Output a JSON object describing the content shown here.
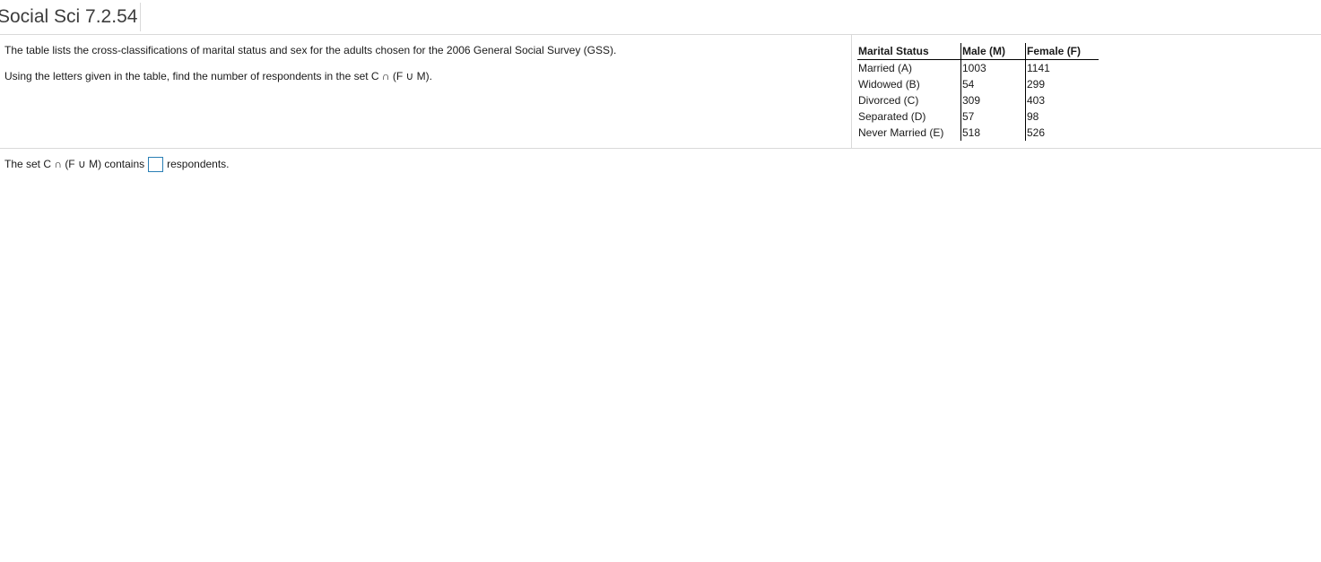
{
  "header": {
    "title": "Social Sci 7.2.54"
  },
  "question": {
    "line1": "The table lists the cross-classifications of marital status and sex for the adults chosen for the 2006 General Social Survey (GSS).",
    "line2": "Using the letters given in the table, find the number of respondents in the set C ∩ (F ∪ M)."
  },
  "table": {
    "headers": [
      "Marital Status",
      "Male (M)",
      "Female (F)"
    ],
    "rows": [
      {
        "status": "Married (A)",
        "male": "1003",
        "female": "1141"
      },
      {
        "status": "Widowed (B)",
        "male": "54",
        "female": "299"
      },
      {
        "status": "Divorced (C)",
        "male": "309",
        "female": "403"
      },
      {
        "status": "Separated (D)",
        "male": "57",
        "female": "98"
      },
      {
        "status": "Never Married (E)",
        "male": "518",
        "female": "526"
      }
    ]
  },
  "answer": {
    "prefix": "The set C ∩ (F ∪ M) contains",
    "suffix": "respondents.",
    "value": ""
  },
  "colors": {
    "input_border": "#2a7fb5",
    "divider": "#d9d9d9"
  }
}
